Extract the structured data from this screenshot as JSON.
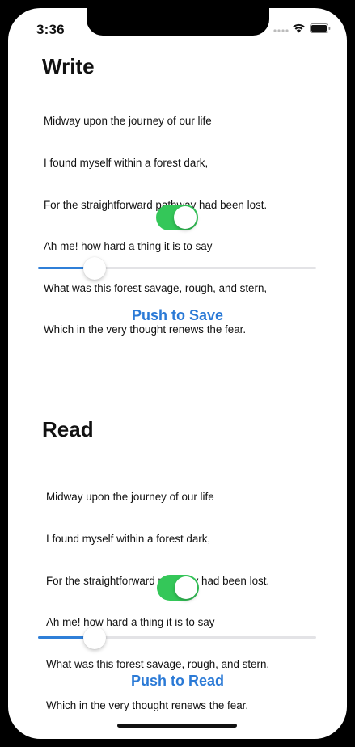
{
  "status_bar": {
    "time": "3:36"
  },
  "write": {
    "title": "Write",
    "poem_lines": [
      "Midway upon the journey of our life",
      "I found myself within a forest dark,",
      "For the straightforward pathway had been lost.",
      "Ah me! how hard a thing it is to say",
      "What was this forest savage, rough, and stern,",
      "Which in the very thought renews the fear."
    ],
    "toggle_on": true,
    "slider_value": 0.18,
    "button_label": "Push to Save"
  },
  "read": {
    "title": "Read",
    "poem_lines": [
      "Midway upon the journey of our life",
      "I found myself within a forest dark,",
      "For the straightforward pathway had been lost.",
      "Ah me! how hard a thing it is to say",
      "What was this forest savage, rough, and stern,",
      "Which in the very thought renews the fear."
    ],
    "toggle_on": true,
    "slider_value": 0.18,
    "button_label": "Push to Read"
  },
  "colors": {
    "accent": "#2b7ad6",
    "toggle_on": "#34c759",
    "slider_fill": "#2f7fd8"
  }
}
